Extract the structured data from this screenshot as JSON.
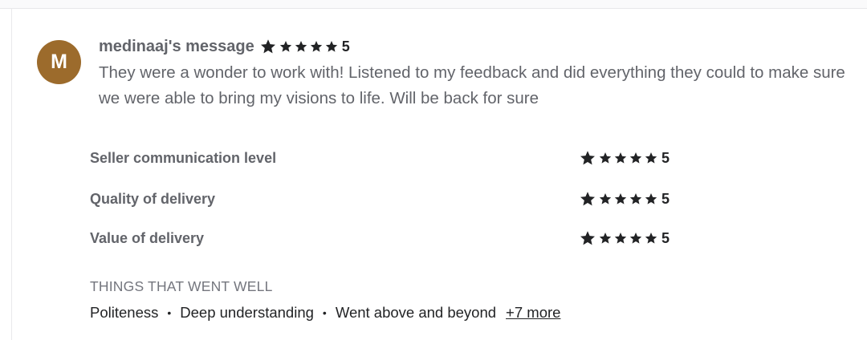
{
  "review": {
    "avatar_letter": "M",
    "avatar_color": "#9c6b2c",
    "reviewer_title": "medinaaj's message",
    "overall_rating": "5",
    "overall_stars": 5,
    "message": "They were a wonder to work with! Listened to my feedback and did everything they could to make sure we were able to bring my visions to life. Will be back for sure"
  },
  "sub_ratings": [
    {
      "label": "Seller communication level",
      "rating": "5",
      "stars": 5
    },
    {
      "label": "Quality of delivery",
      "rating": "5",
      "stars": 5
    },
    {
      "label": "Value of delivery",
      "rating": "5",
      "stars": 5
    }
  ],
  "highlights": {
    "title": "THINGS THAT WENT WELL",
    "tags": [
      "Politeness",
      "Deep understanding",
      "Went above and beyond"
    ],
    "more_link": "+7 more"
  },
  "colors": {
    "star": "#222325",
    "muted_text": "#62646a"
  },
  "icons": [
    "star-icon"
  ]
}
